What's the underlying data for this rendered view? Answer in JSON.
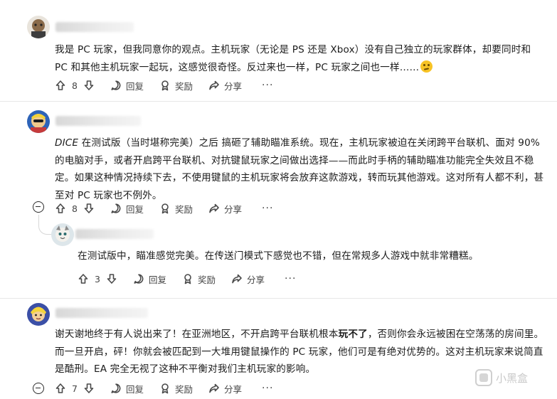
{
  "comments": [
    {
      "id": "c1",
      "body": "我是 PC 玩家，但我同意你的观点。主机玩家（无论是 PS 还是 Xbox）没有自己独立的玩家群体，却要同时和 PC 和其他主机玩家一起玩，这感觉很奇怪。反过来也一样，PC 玩家之间也一样……",
      "emoji": "thinking-face-emoji",
      "votes": "8",
      "actions": {
        "reply": "回复",
        "award": "奖励",
        "share": "分享",
        "more": "···"
      }
    },
    {
      "id": "c2",
      "body_italic": "DICE",
      "body": " 在测试版（当时堪称完美）之后 搞砸了辅助瞄准系统。现在，主机玩家被迫在关闭跨平台联机、面对 90% 的电脑对手，或者开启跨平台联机、对抗键鼠玩家之间做出选择——而此时手柄的辅助瞄准功能完全失效且不稳定。如果这种情况持续下去，不使用键鼠的主机玩家将会放弃这款游戏，转而玩其他游戏。这对所有人都不利，甚至对 PC 玩家也不例外。",
      "votes": "8",
      "actions": {
        "reply": "回复",
        "award": "奖励",
        "share": "分享",
        "more": "···"
      }
    },
    {
      "id": "c3",
      "body": "在测试版中，瞄准感觉完美。在传送门模式下感觉也不错，但在常规多人游戏中就非常糟糕。",
      "votes": "3",
      "actions": {
        "reply": "回复",
        "award": "奖励",
        "share": "分享",
        "more": "···"
      }
    },
    {
      "id": "c4",
      "body_pre": "谢天谢地终于有人说出来了！在亚洲地区，不开启跨平台联机根本",
      "body_bold": "玩不了",
      "body_post": "，否则你会永远被困在空荡荡的房间里。而一旦开启，砰！你就会被匹配到一大堆用键鼠操作的 PC 玩家，他们可是有绝对优势的。这对主机玩家来说简直是酷刑。EA 完全无视了这种不平衡对我们主机玩家的影响。",
      "votes": "7",
      "actions": {
        "reply": "回复",
        "award": "奖励",
        "share": "分享",
        "more": "···"
      }
    }
  ],
  "watermark": {
    "text": "小黑盒"
  },
  "colors": {
    "text": "#1c1c1c",
    "icon": "#4a4a4a",
    "thread": "#d7d7d7",
    "emoji": "#f7c325"
  }
}
